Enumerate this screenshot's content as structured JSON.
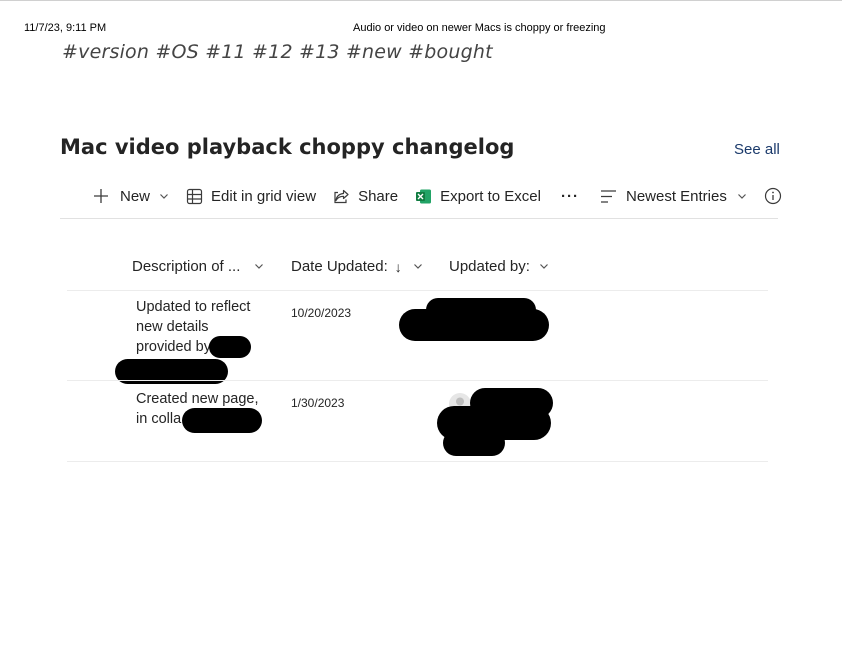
{
  "print_header": {
    "datetime": "11/7/23, 9:11 PM",
    "title": "Audio or video on newer Macs is choppy or freezing"
  },
  "tags": "#version #OS #11 #12 #13 #new #bought",
  "list": {
    "title": "Mac video playback choppy changelog",
    "see_all": "See all"
  },
  "commands": {
    "new": "New",
    "edit_grid": "Edit in grid view",
    "share": "Share",
    "export": "Export to Excel",
    "more": "···",
    "sort": "Newest Entries"
  },
  "columns": {
    "description": "Description of ...",
    "date_updated": "Date Updated:",
    "date_sort_arrow": "↓",
    "updated_by": "Updated by:"
  },
  "rows": [
    {
      "desc_lines": [
        "Updated to reflect",
        "new details",
        "provided by"
      ],
      "date": "10/20/2023"
    },
    {
      "desc_lines": [
        "Created new page,",
        "in colla"
      ],
      "date": "1/30/2023"
    }
  ],
  "colors": {
    "text": "#242424",
    "link": "#1b3a6b",
    "excel_green": "#107c41",
    "redaction": "#000000"
  }
}
